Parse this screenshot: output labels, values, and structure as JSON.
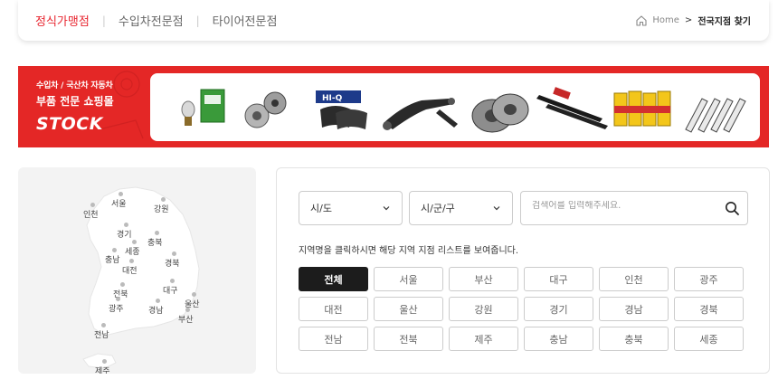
{
  "nav": {
    "tabs": [
      {
        "label": "정식가맹점",
        "active": true
      },
      {
        "label": "수입차전문점",
        "active": false
      },
      {
        "label": "타이어전문점",
        "active": false
      }
    ],
    "separator": "|"
  },
  "breadcrumb": {
    "home": "Home",
    "chevron": ">",
    "current": "전국지점 찾기"
  },
  "banner": {
    "subtitle": "수입차 / 국산차 자동차",
    "title": "부품 전문 쇼핑몰",
    "logo": "STOCK",
    "products": [
      "headlight-bulb",
      "wheel-hub",
      "brake-pads",
      "control-arm",
      "brake-disc",
      "wiper-blades",
      "engine-oil",
      "spark-plugs"
    ],
    "panel_text": "HI-Q"
  },
  "map": {
    "regions": [
      "서울",
      "인천",
      "강원",
      "경기",
      "충북",
      "세종",
      "충남",
      "대전",
      "경북",
      "대구",
      "전북",
      "울산",
      "광주",
      "경남",
      "부산",
      "전남",
      "제주"
    ]
  },
  "search": {
    "sido_label": "시/도",
    "sigungu_label": "시/군/구",
    "placeholder": "검색어를 입력해주세요.",
    "hint": "지역명을 클릭하시면 해당 지역 지점 리스트를 보여줍니다."
  },
  "region_buttons": [
    {
      "label": "전체",
      "active": true
    },
    {
      "label": "서울",
      "active": false
    },
    {
      "label": "부산",
      "active": false
    },
    {
      "label": "대구",
      "active": false
    },
    {
      "label": "인천",
      "active": false
    },
    {
      "label": "광주",
      "active": false
    },
    {
      "label": "대전",
      "active": false
    },
    {
      "label": "울산",
      "active": false
    },
    {
      "label": "강원",
      "active": false
    },
    {
      "label": "경기",
      "active": false
    },
    {
      "label": "경남",
      "active": false
    },
    {
      "label": "경북",
      "active": false
    },
    {
      "label": "전남",
      "active": false
    },
    {
      "label": "전북",
      "active": false
    },
    {
      "label": "제주",
      "active": false
    },
    {
      "label": "충남",
      "active": false
    },
    {
      "label": "충북",
      "active": false
    },
    {
      "label": "세종",
      "active": false
    }
  ],
  "colors": {
    "accent": "#e8252f",
    "banner_red": "#e42726",
    "active_button": "#1c1c1c",
    "map_land": "#ffffff",
    "map_bg": "#f3f3f3",
    "dot": "#bbbbbb"
  }
}
